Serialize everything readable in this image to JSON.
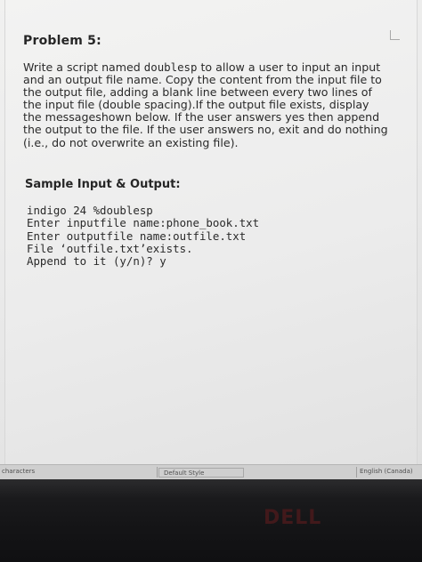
{
  "document": {
    "problem_title": "Problem 5:",
    "description_lines": [
      "Write a script named ",
      "doublesp",
      " to allow a user to input an input and an output file name. Copy the content from the input file to the output file, adding a blank line between every two lines of the input file (double spacing).If the output file exists, display the messageshown below. If the user answers yes then append the output to the file. If the user answers no, exit and do nothing (i.e., do not overwrite an existing file)."
    ],
    "sample_heading": "Sample Input & Output:",
    "sample_lines": [
      "indigo 24 %doublesp",
      "Enter inputfile name:phone_book.txt",
      "Enter outputfile name:outfile.txt",
      "File ‘outfile.txt’exists.",
      "Append to it (y/n)? y"
    ]
  },
  "statusbar": {
    "characters": "characters",
    "page_style": "Default Style",
    "language": "English (Canada)"
  },
  "bezel": {
    "brand": "DELL"
  },
  "colors": {
    "page_bg": "#ececec",
    "text": "#2a2a2a",
    "bezel": "#161618",
    "brand_logo": "#4a1a1c"
  }
}
